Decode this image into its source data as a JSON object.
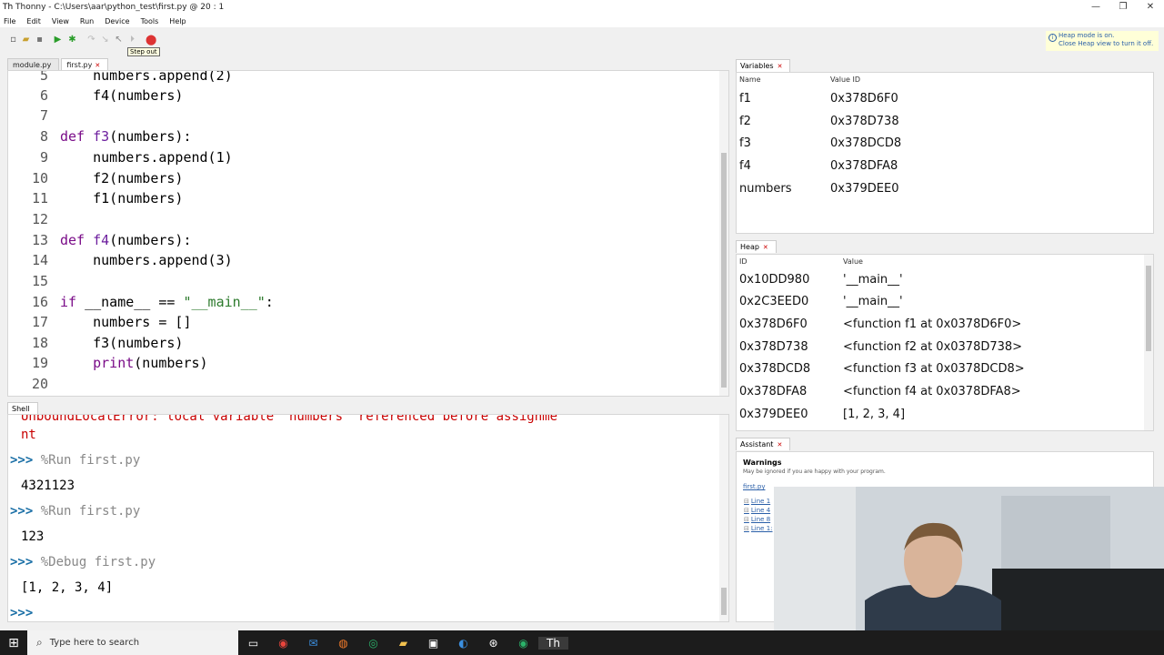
{
  "window": {
    "title": "Thonny - C:\\Users\\aar\\python_test\\first.py @ 20 : 1"
  },
  "menu": [
    "File",
    "Edit",
    "View",
    "Run",
    "Device",
    "Tools",
    "Help"
  ],
  "toolbar": {
    "tooltip": "Step out"
  },
  "heap_notice": {
    "line1": "Heap mode is on.",
    "line2": "Close Heap view to turn it off."
  },
  "editor": {
    "tabs": [
      {
        "label": "module.py",
        "active": false
      },
      {
        "label": "first.py",
        "active": true
      }
    ],
    "line_numbers": [
      "5",
      "6",
      "7",
      "8",
      "9",
      "10",
      "11",
      "12",
      "13",
      "14",
      "15",
      "16",
      "17",
      "18",
      "19",
      "20"
    ],
    "lines": {
      "l5": "    numbers.append(2)",
      "l6": "    f4(numbers)",
      "l8_kw": "def ",
      "l8_fn": "f3",
      "l8_rest": "(numbers):",
      "l9a": "    numbers.append(",
      "l9n": "1",
      "l9b": ")",
      "l10": "    f2(numbers)",
      "l11": "    f1(numbers)",
      "l13_kw": "def ",
      "l13_fn": "f4",
      "l13_rest": "(numbers):",
      "l14a": "    numbers.append(",
      "l14n": "3",
      "l14b": ")",
      "l16_kw": "if",
      "l16_mid": " __name__ == ",
      "l16_str": "\"__main__\"",
      "l16_end": ":",
      "l17": "    numbers = []",
      "l18": "    f3(numbers)",
      "l19_pad": "    ",
      "l19_bi": "print",
      "l19_rest": "(numbers)"
    }
  },
  "shell": {
    "title": "Shell",
    "error_line1": "UnboundLocalError: local variable 'numbers' referenced before assignme",
    "error_line2": "nt",
    "prompt": ">>> ",
    "entries": [
      {
        "cmd": "%Run first.py",
        "output": "4321123"
      },
      {
        "cmd": "%Run first.py",
        "output": "123"
      },
      {
        "cmd": "%Debug first.py",
        "output": "[1, 2, 3, 4]"
      }
    ]
  },
  "variables": {
    "title": "Variables",
    "col_name": "Name",
    "col_value": "Value ID",
    "rows": [
      {
        "name": "f1",
        "value": "0x378D6F0"
      },
      {
        "name": "f2",
        "value": "0x378D738"
      },
      {
        "name": "f3",
        "value": "0x378DCD8"
      },
      {
        "name": "f4",
        "value": "0x378DFA8"
      },
      {
        "name": "numbers",
        "value": "0x379DEE0"
      }
    ]
  },
  "heap": {
    "title": "Heap",
    "col_id": "ID",
    "col_value": "Value",
    "rows": [
      {
        "id": "0x10DD980",
        "value": "'__main__'"
      },
      {
        "id": "0x2C3EED0",
        "value": "'__main__'"
      },
      {
        "id": "0x378D6F0",
        "value": "<function f1 at 0x0378D6F0>"
      },
      {
        "id": "0x378D738",
        "value": "<function f2 at 0x0378D738>"
      },
      {
        "id": "0x378DCD8",
        "value": "<function f3 at 0x0378DCD8>"
      },
      {
        "id": "0x378DFA8",
        "value": "<function f4 at 0x0378DFA8>"
      },
      {
        "id": "0x379DEE0",
        "value": "[1, 2, 3, 4]"
      }
    ]
  },
  "assistant": {
    "title": "Assistant",
    "warnings_title": "Warnings",
    "warnings_sub": "May be ignored if you are happy with your program.",
    "file_link": "first.py",
    "line_refs": [
      "Line 1",
      "Line 4",
      "Line 8",
      "Line 1:"
    ]
  },
  "taskbar": {
    "search_placeholder": "Type here to search"
  },
  "colors": {
    "keyword": "#7a0c88",
    "string": "#2c7a2c",
    "prompt": "#1a6fa6",
    "error": "#c80000"
  }
}
